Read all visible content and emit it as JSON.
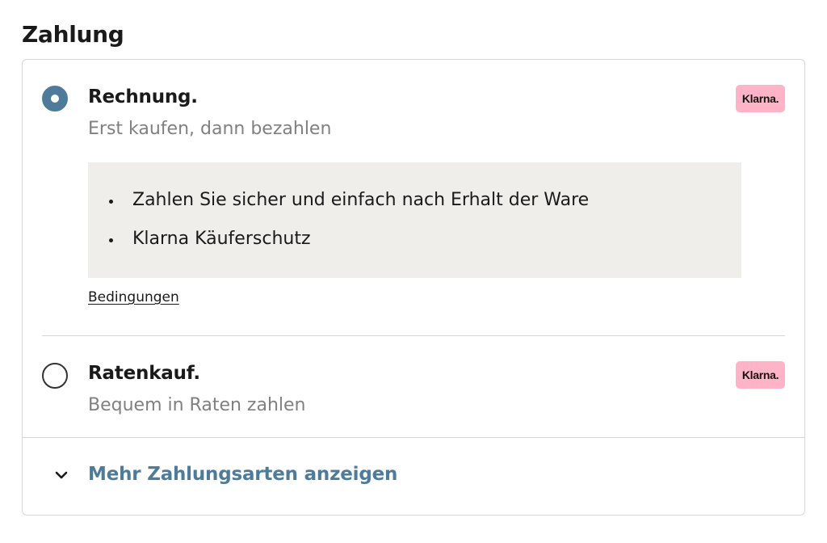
{
  "section": {
    "title": "Zahlung"
  },
  "options": [
    {
      "title": "Rechnung.",
      "subtitle": "Erst kaufen, dann bezahlen",
      "selected": true,
      "badge": "Klarna.",
      "benefits": [
        "Zahlen Sie sicher und einfach nach Erhalt der Ware",
        "Klarna Käuferschutz"
      ],
      "terms_link": "Bedingungen"
    },
    {
      "title": "Ratenkauf.",
      "subtitle": "Bequem in Raten zahlen",
      "selected": false,
      "badge": "Klarna."
    }
  ],
  "more": {
    "label": "Mehr Zahlungsarten anzeigen",
    "icon": "chevron-down-icon"
  },
  "colors": {
    "accent": "#4f7b9b",
    "klarna_badge": "#ffb3c7",
    "info_box": "#efeeeb",
    "border": "#d6d6d6",
    "subtitle_text": "#808080"
  }
}
